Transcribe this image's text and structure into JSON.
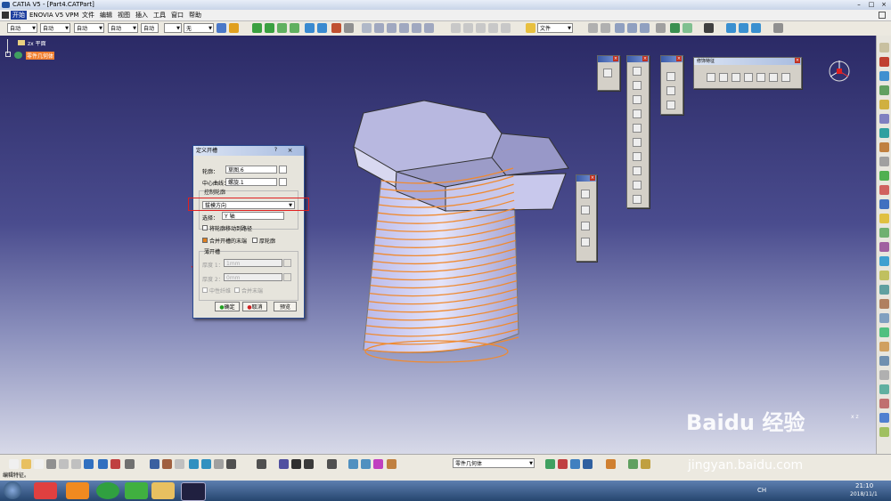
{
  "window": {
    "title": "CATIA V5 - [Part4.CATPart]"
  },
  "menubar": {
    "items": [
      "开始",
      "ENOVIA V5 VPM",
      "文件",
      "编辑",
      "视图",
      "插入",
      "工具",
      "窗口",
      "帮助"
    ]
  },
  "toolbar_top": {
    "combos": [
      "自动",
      "自动",
      "自动",
      "自动",
      "自动",
      "无"
    ],
    "file_combo": "文件"
  },
  "tree": {
    "root": "zx 平面",
    "node": "零件几何体"
  },
  "floating_toolbar": {
    "title": "修饰特征"
  },
  "dialog": {
    "title": "定义开槽",
    "help": "?",
    "close": "×",
    "profile_label": "轮廓：",
    "profile_value": "草图.6",
    "center_curve_label": "中心曲线：",
    "center_curve_value": "螺旋.1",
    "control_group": "控制轮廓",
    "control_option": "拔模方向",
    "select_label": "选择：",
    "select_value": "Y 轴",
    "move_profile": "将轮廓移动到路径",
    "merge_ends": "合并开槽的末端",
    "thick_profile": "厚轮廓",
    "thin_group": "薄开槽",
    "thickness1_label": "厚度 1：",
    "thickness1_value": "1mm",
    "thickness2_label": "厚度 2：",
    "thickness2_value": "0mm",
    "neutral_fiber": "中性纤维",
    "merge_ends2": "合并末端",
    "ok": "确定",
    "cancel": "取消",
    "preview": "预览"
  },
  "bottom_toolbar": {
    "body_combo": "零件几何体"
  },
  "status": {
    "text": "编辑特征。"
  },
  "taskbar": {
    "time": "21:10",
    "date": "2018/11/1",
    "ime": "CH"
  },
  "watermark": {
    "brand": "Baidu 经验",
    "url": "jingyan.baidu.com"
  },
  "colors": {
    "viewport_top": "#2b2a66",
    "viewport_bottom": "#d7d9e8",
    "thread": "#f08a30",
    "highlight": "#e02020"
  }
}
